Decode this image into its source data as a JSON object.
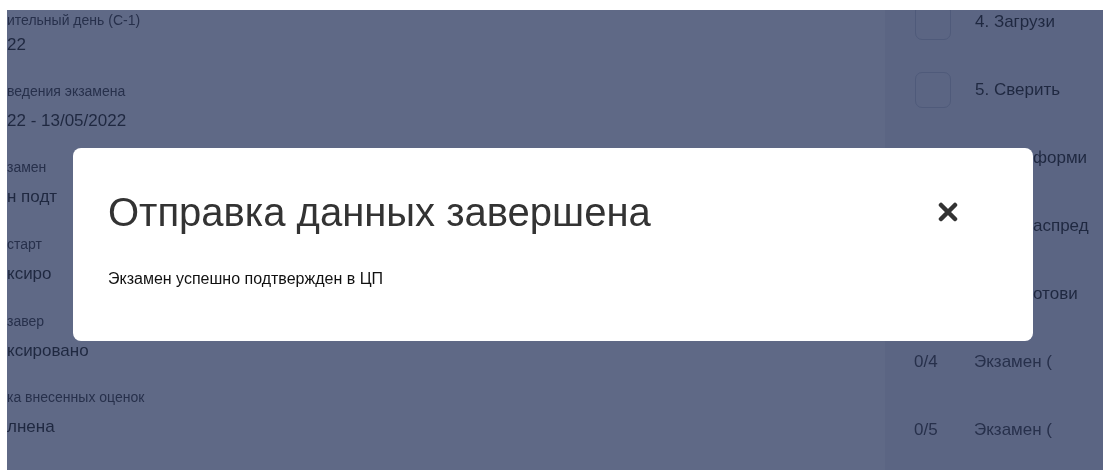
{
  "background": {
    "fields": [
      {
        "label": "ительный день (С-1)",
        "value": "22"
      },
      {
        "label": "ведения экзамена",
        "value": "22 - 13/05/2022"
      },
      {
        "label": "замен",
        "value": "н подт"
      },
      {
        "label": "старт",
        "value": "ксиро"
      },
      {
        "label": "завер",
        "value": "ксировано"
      },
      {
        "label": "ка внесенных оценок",
        "value": "лнена"
      }
    ],
    "checklist": [
      {
        "kind": "checkbox",
        "text": "4. Загрузи",
        "checked": false
      },
      {
        "kind": "checkbox",
        "text": "5. Сверить",
        "checked": false
      },
      {
        "kind": "step",
        "text": "форми"
      },
      {
        "kind": "step",
        "text": "аспред"
      },
      {
        "kind": "step",
        "text": "отови"
      },
      {
        "kind": "count",
        "count": "0/4",
        "text": "Экзамен ("
      },
      {
        "kind": "count",
        "count": "0/5",
        "text": "Экзамен ("
      }
    ]
  },
  "modal": {
    "title": "Отправка данных завершена",
    "message": "Экзамен успешно подтвержден в ЦП"
  }
}
